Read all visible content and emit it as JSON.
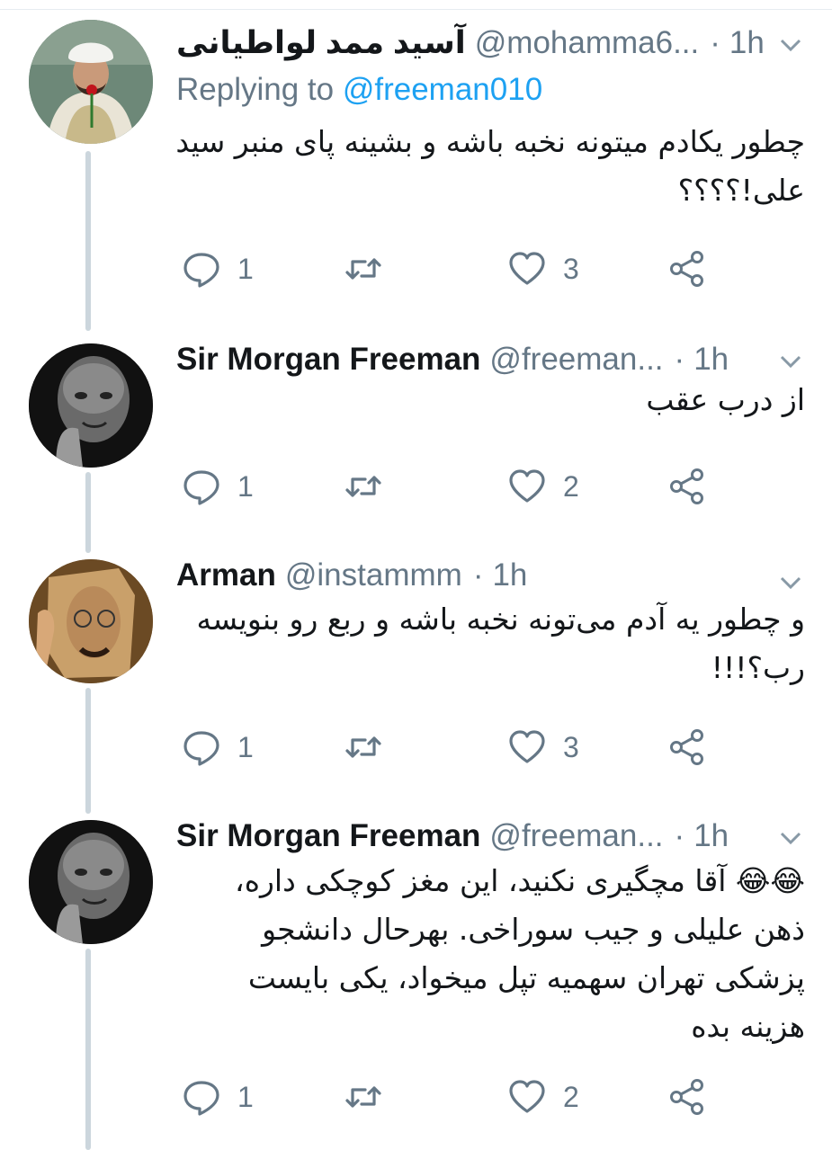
{
  "colors": {
    "accent": "#1da1f2",
    "muted": "#657786",
    "thread_line": "#ccd6dd",
    "text": "#14171a"
  },
  "tweets": [
    {
      "name": "آسید ممد لواطیانی",
      "handle": "@mohamma6...",
      "dot": "·",
      "time": "1h",
      "reply_prefix": "Replying to",
      "reply_to": "@freeman010",
      "text": "چطور یکادم میتونه نخبه باشه و بشینه پای منبر سید علی!؟؟؟؟",
      "reply_count": "1",
      "like_count": "3"
    },
    {
      "name": "Sir Morgan Freeman",
      "handle": "@freeman...",
      "dot": "·",
      "time": "1h",
      "text": "از درب عقب",
      "reply_count": "1",
      "like_count": "2"
    },
    {
      "name": "Arman",
      "handle": "@instammm",
      "dot": "·",
      "time": "1h",
      "text": "و چطور یه آدم می‌تونه نخبه باشه و ربع رو بنویسه رب؟!!!",
      "reply_count": "1",
      "like_count": "3"
    },
    {
      "name": "Sir Morgan Freeman",
      "handle": "@freeman...",
      "dot": "·",
      "time": "1h",
      "text": "😂😂 آقا مچگیری نکنید، این مغز کوچکی داره، ذهن علیلی و جیب سوراخی. بهرحال دانشجو پزشکی تهران سهمیه تپل میخواد، یکی بایست هزینه بده",
      "reply_count": "1",
      "like_count": "2"
    }
  ]
}
